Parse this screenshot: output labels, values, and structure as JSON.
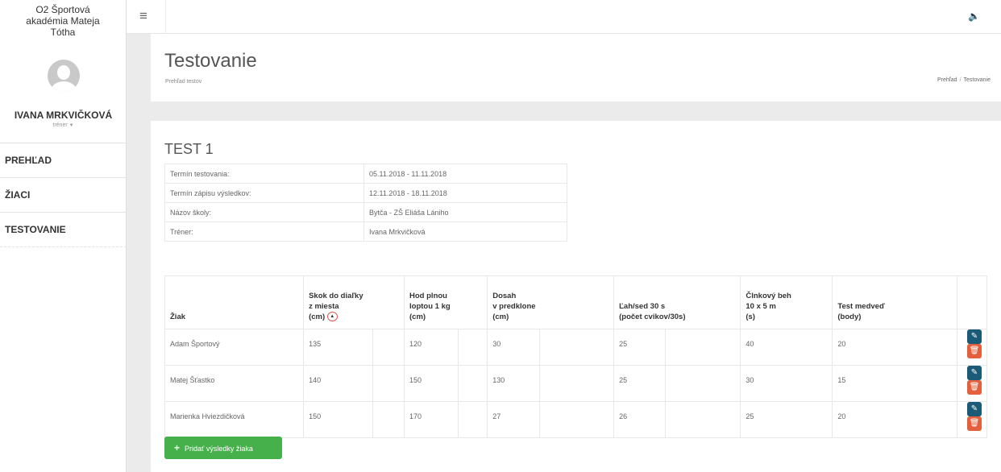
{
  "sidebar": {
    "school_line1": "O2 Športová",
    "school_line2": "akadémia Mateja",
    "school_line3": "Tótha",
    "user_name": "IVANA MRKVIČKOVÁ",
    "user_role": "tréner",
    "items": [
      {
        "label": "PREHĽAD"
      },
      {
        "label": "ŽIACI"
      },
      {
        "label": "TESTOVANIE"
      }
    ]
  },
  "header": {
    "title": "Testovanie",
    "subtitle": "Prehľad testov",
    "breadcrumb": [
      "Prehľad",
      "Testovanie"
    ]
  },
  "test": {
    "title": "TEST 1",
    "info": [
      {
        "label": "Termín testovania:",
        "value": "05.11.2018 - 11.11.2018"
      },
      {
        "label": "Termín zápisu výsledkov:",
        "value": "12.11.2018 - 18.11.2018"
      },
      {
        "label": "Názov školy:",
        "value": "Bytča - ZŠ Eliáša Lániho"
      },
      {
        "label": "Tréner:",
        "value": "Ivana Mrkvičková"
      }
    ]
  },
  "results": {
    "columns": [
      {
        "l1": "Žiak"
      },
      {
        "l1": "Skok do diaľky",
        "l2": "z miesta",
        "l3": "(cm)"
      },
      {
        "l1": "Hod plnou",
        "l2": "loptou 1 kg",
        "l3": "(cm)"
      },
      {
        "l1": "Dosah",
        "l2": "v predklone",
        "l3": "(cm)"
      },
      {
        "l1": "Ľah/sed 30 s",
        "l2": "(počet cvikov/30s)"
      },
      {
        "l1": "Člnkový beh",
        "l2": "10 x 5 m",
        "l3": "(s)"
      },
      {
        "l1": "Test medveď",
        "l2": "(body)"
      }
    ],
    "rows": [
      [
        "Adam Športový",
        "135",
        "120",
        "30",
        "25",
        "40",
        "20"
      ],
      [
        "Matej Šťastko",
        "140",
        "150",
        "130",
        "25",
        "30",
        "15"
      ],
      [
        "Marienka Hviezdičková",
        "150",
        "170",
        "27",
        "26",
        "25",
        "20"
      ]
    ],
    "add_button": "Pridať výsledky žiaka"
  },
  "icons": {
    "menu": "menu-icon",
    "speaker": "speaker-icon",
    "edit": "edit-icon",
    "delete": "trash-icon",
    "sort": "sort-asc-icon"
  },
  "colors": {
    "edit_button": "#1c5b78",
    "delete_button": "#e4603c",
    "add_button": "#46b14a"
  }
}
